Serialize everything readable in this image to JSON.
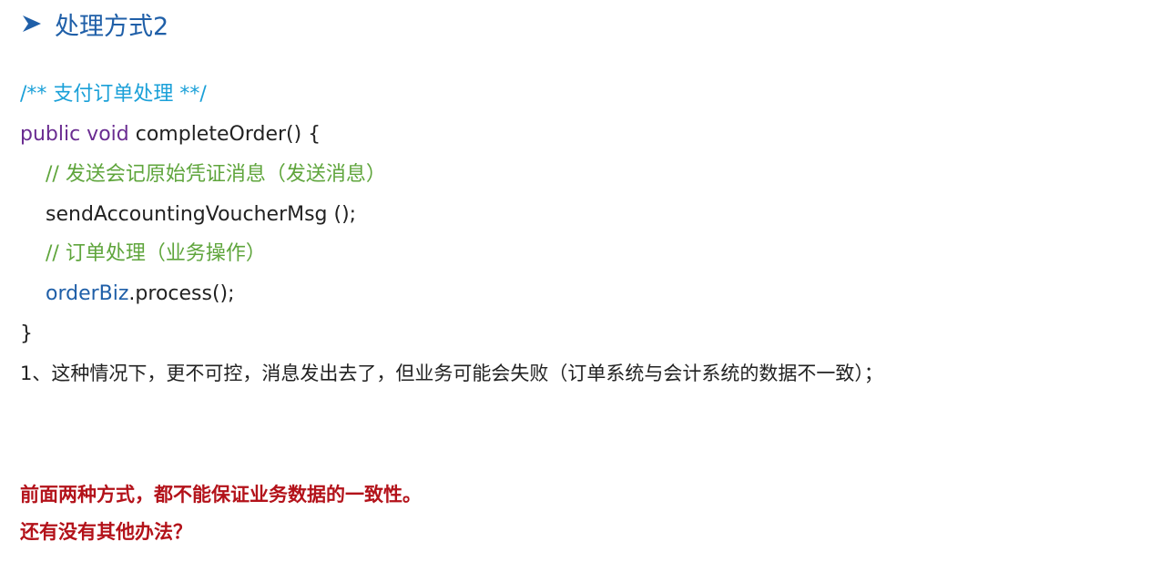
{
  "heading": {
    "icon": "arrow-right-icon",
    "text": "处理方式2"
  },
  "code": {
    "doc_comment": "/** 支付订单处理 **/",
    "signature_keywords": "public void",
    "signature_rest": " completeOrder() {",
    "comment_send": "// 发送会记原始凭证消息（发送消息）",
    "send_call": "sendAccountingVoucherMsg ();",
    "comment_order": "// 订单处理（业务操作）",
    "order_object": "orderBiz",
    "order_method": ".process();",
    "closing_brace": "}"
  },
  "note": "1、这种情况下，更不可控，消息发出去了，但业务可能会失败（订单系统与会计系统的数据不一致）；",
  "conclusion": {
    "line1": "前面两种方式，都不能保证业务数据的一致性。",
    "line2": "还有没有其他办法？"
  },
  "colors": {
    "heading": "#1f5fa8",
    "doc_comment": "#1aa0d8",
    "keyword": "#6a2c91",
    "comment": "#5fa53c",
    "variable": "#1f5fa8",
    "emphasis": "#b3121a"
  }
}
